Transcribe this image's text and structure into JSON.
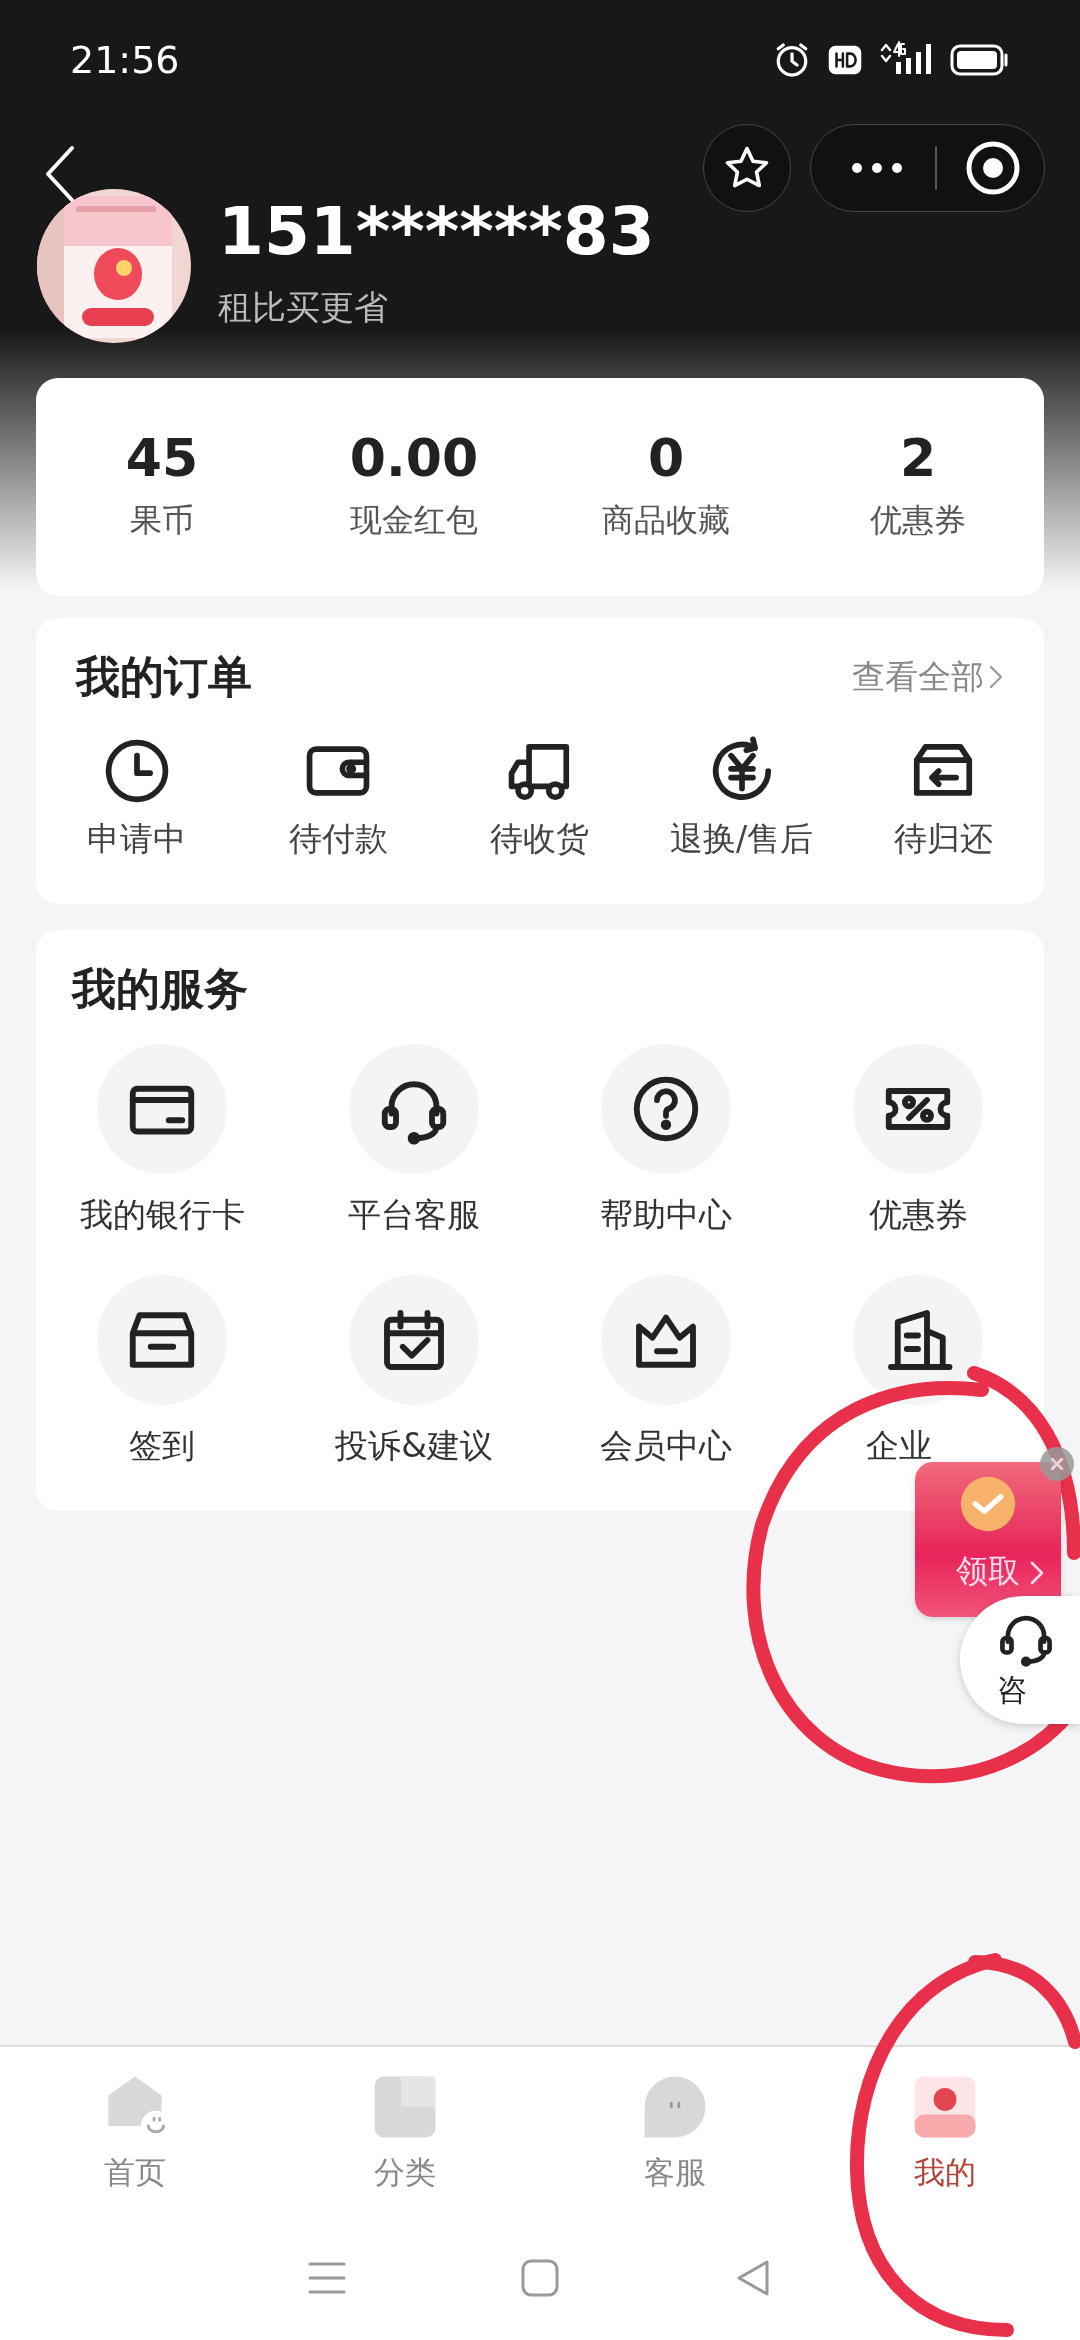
{
  "status_bar": {
    "time": "21:56"
  },
  "profile": {
    "name": "151******83",
    "subtitle": "租比买更省"
  },
  "stats": [
    {
      "value": "45",
      "label": "果币"
    },
    {
      "value": "0.00",
      "label": "现金红包"
    },
    {
      "value": "0",
      "label": "商品收藏"
    },
    {
      "value": "2",
      "label": "优惠券"
    }
  ],
  "orders": {
    "title": "我的订单",
    "link": "查看全部",
    "items": [
      {
        "label": "申请中"
      },
      {
        "label": "待付款"
      },
      {
        "label": "待收货"
      },
      {
        "label": "退换/售后"
      },
      {
        "label": "待归还"
      }
    ]
  },
  "services": {
    "title": "我的服务",
    "items": [
      {
        "label": "我的银行卡"
      },
      {
        "label": "平台客服"
      },
      {
        "label": "帮助中心"
      },
      {
        "label": "优惠券"
      },
      {
        "label": "签到"
      },
      {
        "label": "投诉&建议"
      },
      {
        "label": "会员中心"
      },
      {
        "label": "企业"
      }
    ]
  },
  "floating": {
    "packet": "领取",
    "consult": "咨"
  },
  "tabs": [
    {
      "label": "首页",
      "selected": false
    },
    {
      "label": "分类",
      "selected": false
    },
    {
      "label": "客服",
      "selected": false
    },
    {
      "label": "我的",
      "selected": true
    }
  ]
}
